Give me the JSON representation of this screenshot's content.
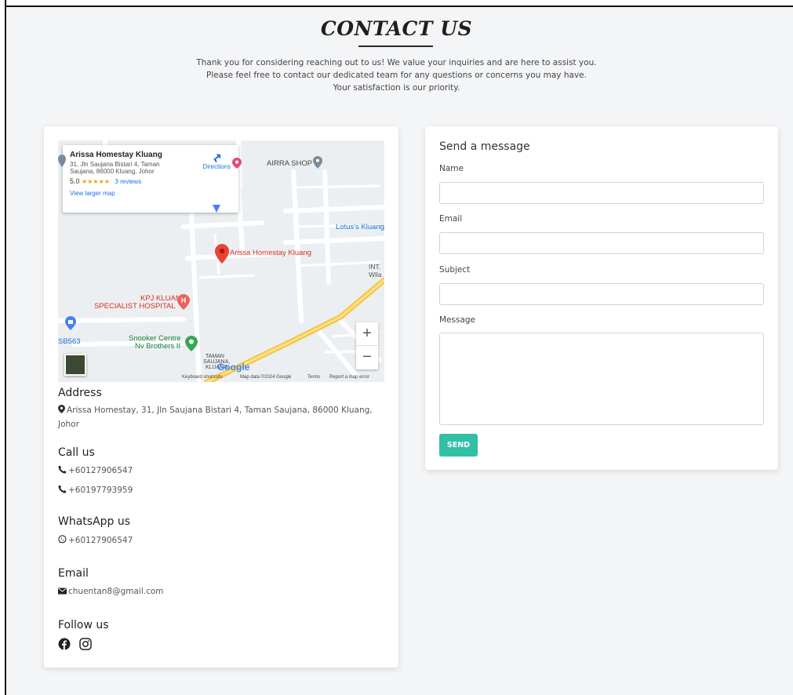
{
  "header": {
    "title": "CONTACT US",
    "intro": [
      "Thank you for considering reaching out to us! We value your inquiries and are here to assist you.",
      "Please feel free to contact our dedicated team for any questions or concerns you may have.",
      "Your satisfaction is our priority."
    ]
  },
  "map": {
    "info": {
      "name": "Arissa Homestay Kluang",
      "address": "31, Jln Saujana Bistari 4, Taman Saujana, 86000 Kluang, Johor",
      "rating": "5.0",
      "stars": "★★★★★",
      "reviews": "3 reviews",
      "larger_map": "View larger map",
      "directions": "Directions"
    },
    "labels": {
      "airra_shop": "AIRRA SHOP",
      "lotus": "Lotus's Kluang",
      "pin_label": "Arissa Homestay Kluang",
      "int": "INT.",
      "wila": "Wila",
      "kpj_1": "KPJ KLUANG",
      "kpj_2": "SPECIALIST HOSPITAL",
      "sb563": "SB563",
      "snooker_1": "Snooker Centre",
      "snooker_2": "Nv Brothers II",
      "taman_1": "TAMAN",
      "taman_2": "SAUJANA,",
      "taman_3": "KLUANG",
      "google": "Google"
    },
    "footer": {
      "shortcuts": "Keyboard shortcuts",
      "data": "Map data ©2024 Google",
      "terms": "Terms",
      "report": "Report a map error"
    },
    "zoom_in": "+",
    "zoom_out": "−"
  },
  "contact": {
    "address_heading": "Address",
    "address": "Arissa Homestay, 31, Jln Saujana Bistari 4, Taman Saujana, 86000 Kluang, Johor",
    "call_heading": "Call us",
    "phones": [
      "+60127906547",
      "+60197793959"
    ],
    "whatsapp_heading": "WhatsApp us",
    "whatsapp": "+60127906547",
    "email_heading": "Email",
    "email": "chuentan8@gmail.com",
    "follow_heading": "Follow us",
    "social_icons": [
      "facebook-icon",
      "instagram-icon"
    ]
  },
  "form": {
    "title": "Send a message",
    "name_label": "Name",
    "email_label": "Email",
    "subject_label": "Subject",
    "message_label": "Message",
    "name_value": "",
    "email_value": "",
    "subject_value": "",
    "message_value": "",
    "send_label": "SEND"
  },
  "colors": {
    "accent": "#32bfa6",
    "background": "#f4f5f7",
    "map_pin": "#ea4335",
    "link": "#1a73e8"
  }
}
